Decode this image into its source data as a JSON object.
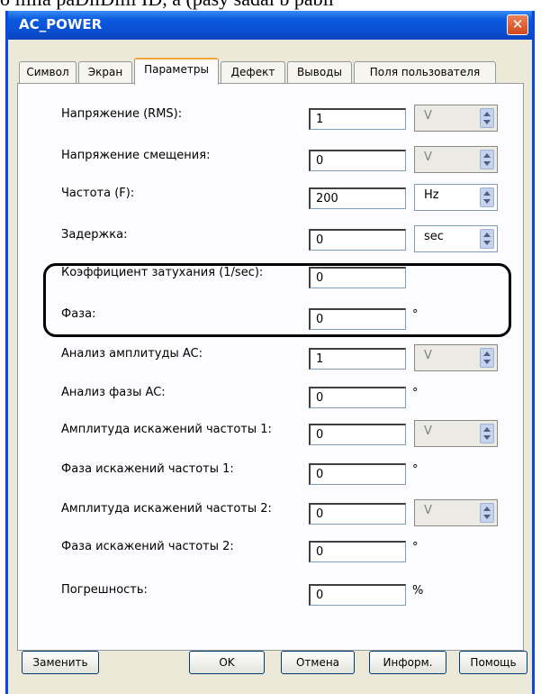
{
  "above_text": "o   iiiiia   paDiiDiiii   ID,   a   (pasy   sadai b   pabii",
  "window": {
    "title": "AC_POWER",
    "close_symbol": "✕"
  },
  "tabs": [
    "Символ",
    "Экран",
    "Параметры",
    "Дефект",
    "Выводы",
    "Поля пользователя"
  ],
  "fields": [
    {
      "label": "Напряжение (RMS):",
      "value": "1",
      "unit": "V",
      "unit_type": "select",
      "enabled": false
    },
    {
      "label": "Напряжение смещения:",
      "value": "0",
      "unit": "V",
      "unit_type": "select",
      "enabled": false
    },
    {
      "label": "Частота (F):",
      "value": "200",
      "unit": "Hz",
      "unit_type": "select",
      "enabled": true
    },
    {
      "label": "Задержка:",
      "value": "0",
      "unit": "sec",
      "unit_type": "select",
      "enabled": true
    },
    {
      "label": "Коэффициент затухания (1/sec):",
      "value": "0",
      "unit": "",
      "unit_type": "none",
      "enabled": false
    },
    {
      "label": "Фаза:",
      "value": "0",
      "unit": "°",
      "unit_type": "text",
      "enabled": false
    },
    {
      "label": "Анализ амплитуды AC:",
      "value": "1",
      "unit": "V",
      "unit_type": "select",
      "enabled": false
    },
    {
      "label": "Анализ фазы AC:",
      "value": "0",
      "unit": "°",
      "unit_type": "text",
      "enabled": false
    },
    {
      "label": "Амплитуда искажений частоты 1:",
      "value": "0",
      "unit": "V",
      "unit_type": "select",
      "enabled": false
    },
    {
      "label": "Фаза искажений частоты 1:",
      "value": "0",
      "unit": "°",
      "unit_type": "text",
      "enabled": false
    },
    {
      "label": "Амплитуда искажений частоты 2:",
      "value": "0",
      "unit": "V",
      "unit_type": "select",
      "enabled": false
    },
    {
      "label": "Фаза искажений частоты 2:",
      "value": "0",
      "unit": "°",
      "unit_type": "text",
      "enabled": false
    },
    {
      "label": "Погрешность:",
      "value": "0",
      "unit": "%",
      "unit_type": "text",
      "enabled": false
    }
  ],
  "buttons": {
    "replace": "Заменить",
    "ok": "OK",
    "cancel": "Отмена",
    "info": "Информ.",
    "help": "Помощь"
  },
  "colors": {
    "title_bar": "#0a4fd2",
    "active_tab_accent": "#f7a43b",
    "dialog_bg": "#ece9d8"
  }
}
